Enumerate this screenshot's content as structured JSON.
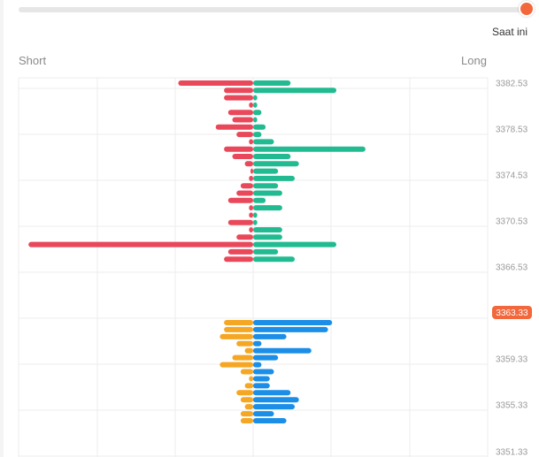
{
  "header": {
    "time_label": "Saat ini",
    "slider_value_pct": 100
  },
  "chart_data": {
    "type": "bar",
    "orientation": "horizontal-diverging",
    "left_label": "Short",
    "right_label": "Long",
    "y_ticks": [
      "3382.53",
      "3378.53",
      "3374.53",
      "3370.53",
      "3366.53",
      "3359.33",
      "3355.33",
      "3351.33"
    ],
    "current_price": "3363.33",
    "price_marker_color": "#f2683c",
    "colors": {
      "short_above": "#e8485a",
      "long_above": "#22bb91",
      "short_below": "#f5a623",
      "long_below": "#1b8ee8"
    },
    "rows_above": [
      {
        "short": 18,
        "long": 9
      },
      {
        "short": 7,
        "long": 20
      },
      {
        "short": 7,
        "long": 1
      },
      {
        "short": 1,
        "long": 1
      },
      {
        "short": 6,
        "long": 2
      },
      {
        "short": 5,
        "long": 1
      },
      {
        "short": 9,
        "long": 3
      },
      {
        "short": 4,
        "long": 2
      },
      {
        "short": 1,
        "long": 5
      },
      {
        "short": 7,
        "long": 27
      },
      {
        "short": 5,
        "long": 9
      },
      {
        "short": 2,
        "long": 11
      },
      {
        "short": 0,
        "long": 6
      },
      {
        "short": 1,
        "long": 10
      },
      {
        "short": 3,
        "long": 6
      },
      {
        "short": 4,
        "long": 7
      },
      {
        "short": 6,
        "long": 3
      },
      {
        "short": 1,
        "long": 7
      },
      {
        "short": 1,
        "long": 1
      },
      {
        "short": 6,
        "long": 1
      },
      {
        "short": 1,
        "long": 7
      },
      {
        "short": 4,
        "long": 7
      },
      {
        "short": 54,
        "long": 20
      },
      {
        "short": 6,
        "long": 6
      },
      {
        "short": 7,
        "long": 10
      }
    ],
    "rows_below": [
      {
        "short": 7,
        "long": 19
      },
      {
        "short": 7,
        "long": 18
      },
      {
        "short": 8,
        "long": 8
      },
      {
        "short": 4,
        "long": 2
      },
      {
        "short": 2,
        "long": 14
      },
      {
        "short": 5,
        "long": 6
      },
      {
        "short": 8,
        "long": 2
      },
      {
        "short": 3,
        "long": 5
      },
      {
        "short": 1,
        "long": 4
      },
      {
        "short": 2,
        "long": 4
      },
      {
        "short": 4,
        "long": 9
      },
      {
        "short": 3,
        "long": 11
      },
      {
        "short": 2,
        "long": 10
      },
      {
        "short": 3,
        "long": 5
      },
      {
        "short": 3,
        "long": 8
      }
    ]
  }
}
